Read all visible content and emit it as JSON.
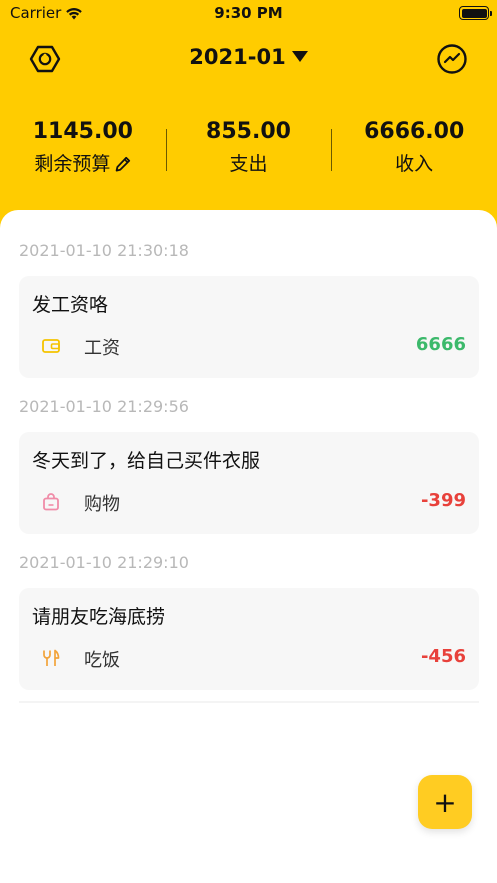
{
  "status_bar": {
    "carrier": "Carrier",
    "time": "9:30 PM"
  },
  "nav": {
    "month": "2021-01",
    "left_icon": "settings-hexagon-icon",
    "right_icon": "chart-circle-icon"
  },
  "summary": {
    "remaining": {
      "amount": "1145.00",
      "label": "剩余预算"
    },
    "expense": {
      "amount": "855.00",
      "label": "支出"
    },
    "income": {
      "amount": "6666.00",
      "label": "收入"
    }
  },
  "records": [
    {
      "time": "2021-01-10 21:30:18",
      "note": "发工资咯",
      "category": "工资",
      "category_icon": "wallet-icon",
      "icon_color": "#F5C400",
      "amount": "6666",
      "type": "income"
    },
    {
      "time": "2021-01-10 21:29:56",
      "note": "冬天到了，给自己买件衣服",
      "category": "购物",
      "category_icon": "shopping-bag-icon",
      "icon_color": "#F08CA8",
      "amount": "-399",
      "type": "expense"
    },
    {
      "time": "2021-01-10 21:29:10",
      "note": "请朋友吃海底捞",
      "category": "吃饭",
      "category_icon": "utensils-icon",
      "icon_color": "#F2A33A",
      "amount": "-456",
      "type": "expense"
    }
  ],
  "fab": {
    "label": "+"
  },
  "colors": {
    "brand_yellow": "#FFCC00",
    "income_green": "#3cb96b",
    "expense_red": "#e8413b"
  }
}
